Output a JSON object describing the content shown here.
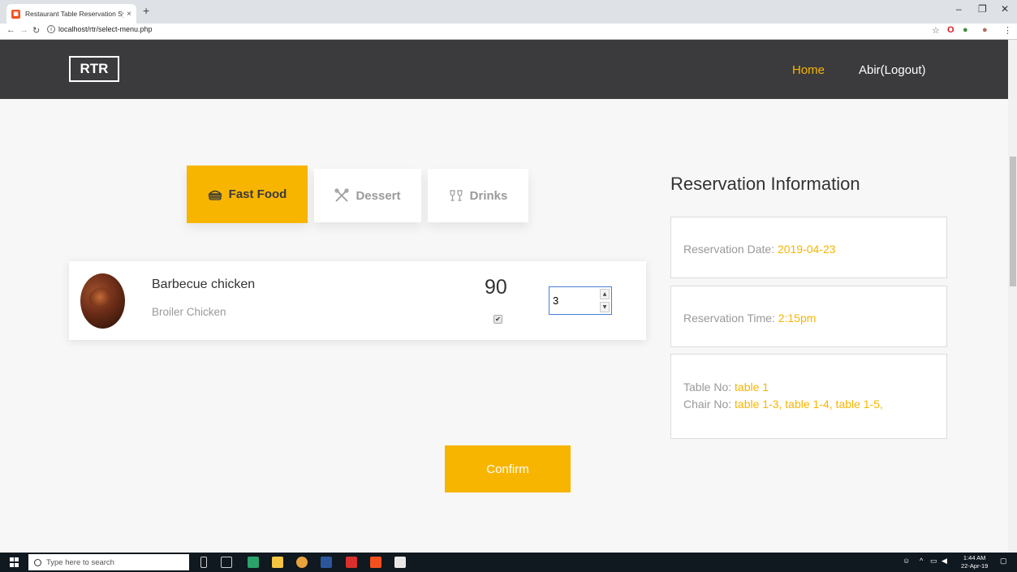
{
  "browser": {
    "tab_title": "Restaurant Table Reservation Sys:",
    "tab_close": "×",
    "new_tab": "+",
    "url": "localhost/rtr/select-menu.php",
    "window_controls": [
      "–",
      "❐",
      "✕"
    ]
  },
  "navbar": {
    "logo": "RTR",
    "home": "Home",
    "logout": "Abir(Logout)"
  },
  "categories": [
    {
      "label": "Fast Food",
      "icon": "burger-icon",
      "active": true
    },
    {
      "label": "Dessert",
      "icon": "utensils-icon",
      "active": false
    },
    {
      "label": "Drinks",
      "icon": "cheers-icon",
      "active": false
    }
  ],
  "menu_item": {
    "name": "Barbecue chicken",
    "category": "Broiler Chicken",
    "price": "90",
    "quantity": "3",
    "checked": true
  },
  "confirm_label": "Confirm",
  "reservation": {
    "title": "Reservation Information",
    "date_label": "Reservation Date: ",
    "date_value": "2019-04-23",
    "time_label": "Reservation Time: ",
    "time_value": "2:15pm",
    "table_label": "Table No: ",
    "table_value": "table 1",
    "chair_label": "Chair No: ",
    "chair_value": "table 1-3, table 1-4, table 1-5,"
  },
  "taskbar": {
    "search_placeholder": "Type here to search",
    "time": "1:44 AM",
    "date": "22-Apr-19"
  },
  "colors": {
    "accent": "#f7b500",
    "navbar": "#3b3b3d",
    "focus_border": "#4a7fd4"
  }
}
